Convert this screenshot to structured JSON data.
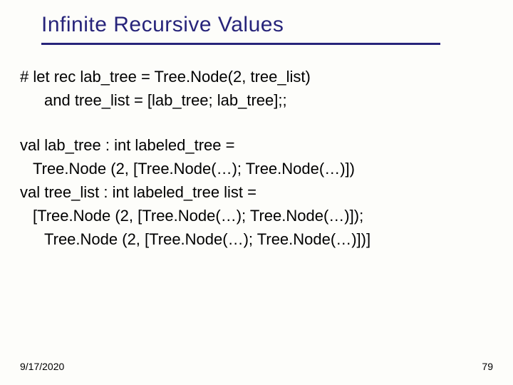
{
  "title": "Infinite Recursive Values",
  "code": {
    "line1": "# let rec lab_tree = Tree.Node(2, tree_list)",
    "line2": "and tree_list = [lab_tree; lab_tree];;"
  },
  "output": {
    "line1": "val lab_tree : int labeled_tree =",
    "line2": "Tree.Node (2, [Tree.Node(…); Tree.Node(…)])",
    "line3": "val tree_list : int labeled_tree list =",
    "line4": "[Tree.Node (2, [Tree.Node(…); Tree.Node(…)]);",
    "line5": "Tree.Node (2, [Tree.Node(…); Tree.Node(…)])]"
  },
  "footer": {
    "date": "9/17/2020",
    "page": "79"
  }
}
